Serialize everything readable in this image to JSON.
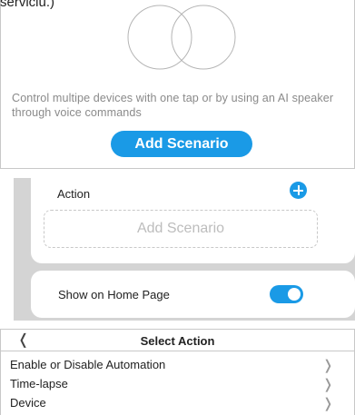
{
  "top_text": "serviciu.)",
  "intro": {
    "description": "Control multipe devices with one tap or by using an AI speaker through voice commands",
    "add_button": "Add Scenario"
  },
  "action_section": {
    "label": "Action",
    "placeholder": "Add Scenario"
  },
  "home_page": {
    "label": "Show on Home Page",
    "enabled": true
  },
  "select_action": {
    "title": "Select Action",
    "items": [
      {
        "label": "Enable or Disable Automation"
      },
      {
        "label": "Time-lapse"
      },
      {
        "label": "Device"
      }
    ]
  },
  "icons": {
    "back": "chevron-left-icon",
    "add": "plus-circle-icon",
    "item_arrow": "chevron-right-icon",
    "illustration": "overlapping-circles-icon"
  },
  "colors": {
    "accent": "#1a9ae6",
    "section_bg": "#d4d4d4",
    "muted_text": "#8a8a8a"
  }
}
